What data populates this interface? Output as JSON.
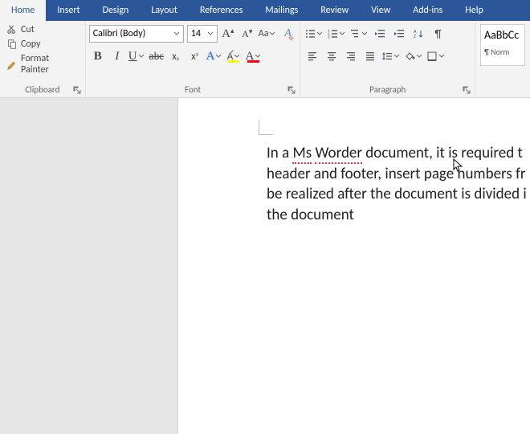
{
  "ribbon": {
    "tabs": [
      "Home",
      "Insert",
      "Design",
      "Layout",
      "References",
      "Mailings",
      "Review",
      "View",
      "Add-ins",
      "Help"
    ],
    "active": "Home"
  },
  "clipboard": {
    "cut": "Cut",
    "copy": "Copy",
    "format_painter": "Format Painter",
    "label": "Clipboard"
  },
  "font": {
    "name": "Calibri (Body)",
    "size": "14",
    "grow": "A",
    "shrink": "A",
    "case": "Aa",
    "clear": "A",
    "bold": "B",
    "italic": "I",
    "underline": "U",
    "strike": "abc",
    "subscript": "x",
    "superscript": "x",
    "highlight_letter": "A",
    "font_color_letter": "A",
    "text_effects_letter": "A",
    "label": "Font"
  },
  "paragraph": {
    "label": "Paragraph"
  },
  "styles": {
    "preview_big": "AaBbCc",
    "preview_small": "¶ Norm"
  },
  "colors": {
    "accent": "#2b579a",
    "highlight": "#ffff00",
    "font_color": "#ff0000"
  },
  "document": {
    "line1_pre": "In a ",
    "err1": "Ms",
    "line1_mid": " ",
    "err2": "Worder",
    "line1_post": " document, it is required t",
    "line2": "header and footer, insert page numbers fr",
    "line3": "be realized after the document is divided i",
    "line4": "the document"
  }
}
